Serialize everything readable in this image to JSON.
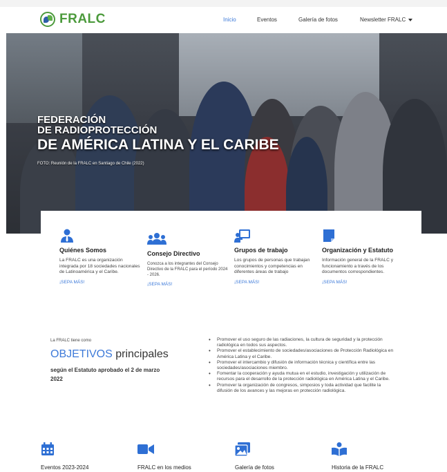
{
  "brand": {
    "name": "FRALC"
  },
  "nav": [
    {
      "label": "Inicio",
      "active": true
    },
    {
      "label": "Eventos",
      "active": false
    },
    {
      "label": "Galería de fotos",
      "active": false
    },
    {
      "label": "Newsletter FRALC",
      "active": false,
      "has_dropdown": true
    }
  ],
  "hero": {
    "title_line1": "FEDERACIÓN",
    "title_line2": "DE RADIOPROTECCIÓN",
    "title_line3": "DE AMÉRICA LATINA Y EL CARIBE",
    "caption": "FOTO: Reunión de la FRALC en Santiago de Chile (2022)"
  },
  "cards": [
    {
      "icon": "user-tie-icon",
      "title": "Quiénes Somos",
      "text": "La FRALC es una organización integrada por 18 sociedades nacionales de Latinoamérica y el Caribe.",
      "link": "¡SEPA MÁS!"
    },
    {
      "icon": "users-icon",
      "title": "Consejo Directivo",
      "text": "Conozca a los integrantes del Consejo Directivo de la FRALC para el período 2024 - 2026.",
      "link": "¡SEPA MÁS!"
    },
    {
      "icon": "chalkboard-teacher-icon",
      "title": "Grupos de trabajo",
      "text": "Los grupos de personas que trabajan conocimientos y competencias en diferentes áreas de trabajo",
      "link": "¡SEPA MÁS!"
    },
    {
      "icon": "document-icon",
      "title": "Organización y Estatuto",
      "text": "Información general de la FRALC y funcionamiento a través de los documentos correspondientes.",
      "link": "¡SEPA MÁS!"
    }
  ],
  "objectives": {
    "small": "La FRALC tiene como",
    "head_blue": "OBJETIVOS",
    "head_rest": " principales",
    "sub": "según el Estatuto aprobado el 2 de marzo 2022",
    "items": [
      "Promover el uso seguro de las radiaciones, la cultura de seguridad y la protección radiológica en todos sus aspectos.",
      "Promover el establecimiento de sociedades/asociaciones de Protección Radiológica en América Latina y el Caribe.",
      "Promover el intercambio y difusión de información técnica y científica entre las sociedades/asociaciones miembro.",
      "Fomentar la cooperación y ayuda mutua en el estudio, investigación y utilización de recursos para el desarrollo de la protección radiológica en América Latina y el Caribe.",
      "Promover la organización de congresos, simposios y toda actividad que facilite la difusión de los avances y las mejoras en protección radiológica."
    ]
  },
  "bottom": [
    {
      "icon": "calendar-icon",
      "title": "Eventos 2023-2024"
    },
    {
      "icon": "video-icon",
      "title": "FRALC en los medios"
    },
    {
      "icon": "photo-gallery-icon",
      "title": "Galería de fotos"
    },
    {
      "icon": "book-reader-icon",
      "title": "Historia de la FRALC"
    }
  ],
  "colors": {
    "accent": "#3d7ad9",
    "brand_green": "#4c9a3c",
    "icon_blue": "#2e6fd4"
  }
}
